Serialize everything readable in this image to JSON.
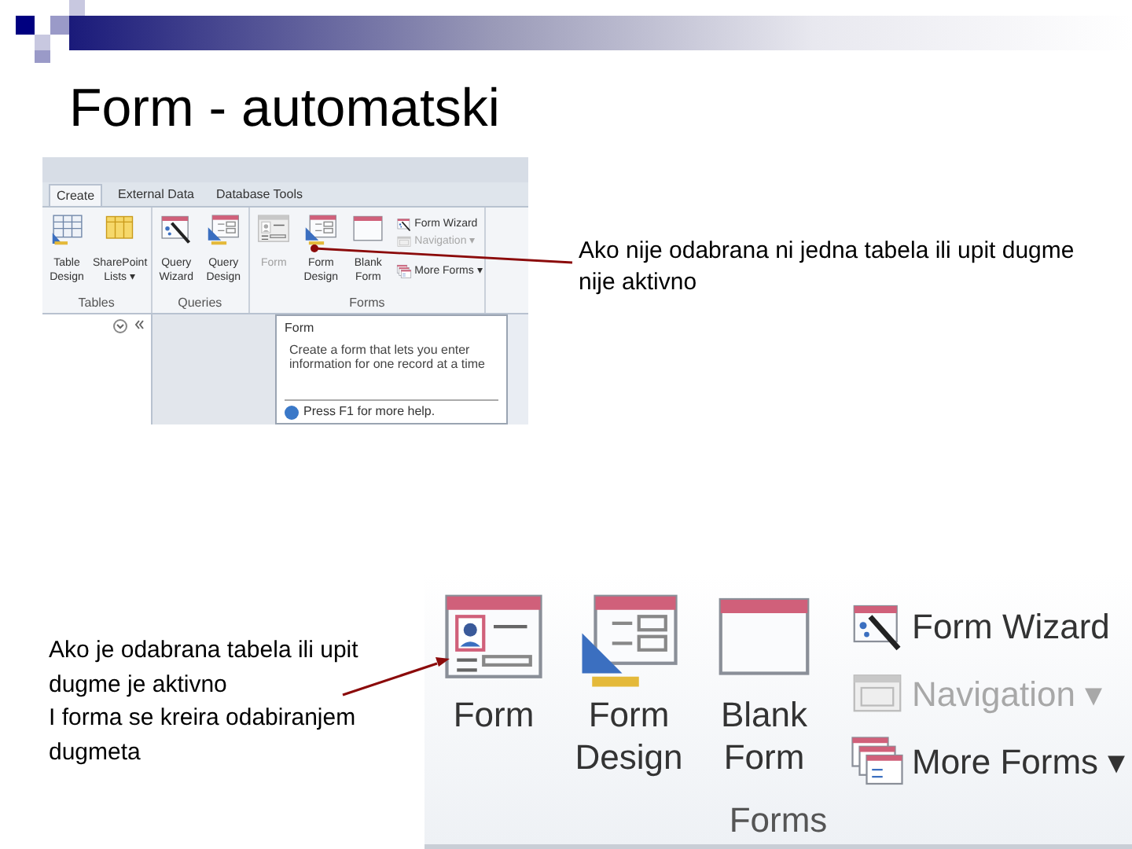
{
  "title": "Form - automatski",
  "small_screenshot": {
    "tabs": [
      {
        "label": "Create",
        "selected": true
      },
      {
        "label": "External Data",
        "selected": false
      },
      {
        "label": "Database Tools",
        "selected": false
      }
    ],
    "groups": [
      {
        "label": "Tables",
        "buttons": [
          {
            "label": "Table\nDesign",
            "kind": "table",
            "disabled": false
          },
          {
            "label": "SharePoint\nLists ▾",
            "kind": "list",
            "disabled": false
          }
        ]
      },
      {
        "label": "Queries",
        "buttons": [
          {
            "label": "Query\nWizard",
            "kind": "wizard",
            "disabled": false
          },
          {
            "label": "Query\nDesign",
            "kind": "design",
            "disabled": false
          }
        ]
      },
      {
        "label": "Forms",
        "buttons": [
          {
            "label": "Form",
            "kind": "form",
            "disabled": true
          },
          {
            "label": "Form\nDesign",
            "kind": "design",
            "disabled": false
          },
          {
            "label": "Blank\nForm",
            "kind": "blank",
            "disabled": false
          }
        ],
        "side_buttons": [
          {
            "label": "Form Wizard",
            "kind": "wizard",
            "disabled": false
          },
          {
            "label": "Navigation ▾",
            "kind": "nav",
            "disabled": true
          },
          {
            "label": "More Forms ▾",
            "kind": "multi",
            "disabled": false
          }
        ]
      }
    ],
    "tooltip": {
      "title": "Form",
      "text": "Create a form that lets you enter information for one record at a time",
      "help": "Press F1 for more help."
    }
  },
  "callout_top": "Ako nije odabrana ni jedna tabela ili upit dugme nije aktivno",
  "callout_bottom": "Ako je odabrana tabela ili upit dugme je aktivno\nI forma se kreira odabiranjem dugmeta",
  "large_screenshot": {
    "group": {
      "label": "Forms",
      "buttons": [
        {
          "label": "Form",
          "kind": "form",
          "disabled": false
        },
        {
          "label": "Form\nDesign",
          "kind": "design",
          "disabled": false
        },
        {
          "label": "Blank\nForm",
          "kind": "blank",
          "disabled": false
        }
      ],
      "side_buttons": [
        {
          "label": "Form Wizard",
          "kind": "wizard",
          "disabled": false
        },
        {
          "label": "Navigation ▾",
          "kind": "nav",
          "disabled": true
        },
        {
          "label": "More Forms ▾",
          "kind": "multi",
          "disabled": false
        }
      ]
    }
  }
}
